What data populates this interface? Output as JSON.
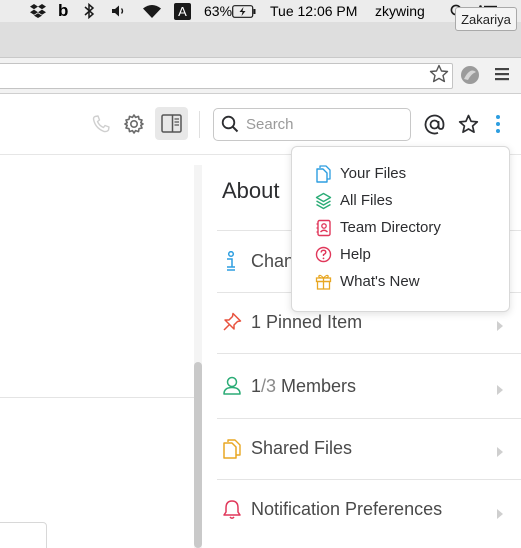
{
  "menubar": {
    "battery": "63%",
    "datetime": "Tue 12:06 PM",
    "username": "zkywing",
    "input_source": "A",
    "icons": [
      "dropbox-icon",
      "b-app-icon",
      "bluetooth-icon",
      "volume-icon",
      "wifi-icon",
      "input-source-icon",
      "battery-icon",
      "spotlight-icon",
      "notification-center-icon"
    ]
  },
  "browser": {
    "profile_name": "Zakariya"
  },
  "header": {
    "search_placeholder": "Search"
  },
  "about": {
    "title": "About",
    "sections": [
      {
        "label": "Chan",
        "icon": "info-icon",
        "color": "#2d9ee0"
      },
      {
        "label": "1 Pinned Item",
        "icon": "pin-icon",
        "color": "#e8533f"
      },
      {
        "label_prefix": "1",
        "label_muted": "/3",
        "label_suffix": " Members",
        "icon": "person-icon",
        "color": "#2bac76"
      },
      {
        "label": "Shared Files",
        "icon": "files-icon",
        "color": "#e8a723"
      },
      {
        "label": "Notification Preferences",
        "icon": "bell-icon",
        "color": "#e0375a"
      }
    ]
  },
  "menu": {
    "items": [
      {
        "label": "Your Files",
        "icon": "your-files-icon",
        "color": "#2d9ee0"
      },
      {
        "label": "All Files",
        "icon": "all-files-icon",
        "color": "#2bac76"
      },
      {
        "label": "Team Directory",
        "icon": "team-directory-icon",
        "color": "#e0375a"
      },
      {
        "label": "Help",
        "icon": "help-icon",
        "color": "#e0375a"
      },
      {
        "label": "What's New",
        "icon": "gift-icon",
        "color": "#e8a723"
      }
    ]
  }
}
